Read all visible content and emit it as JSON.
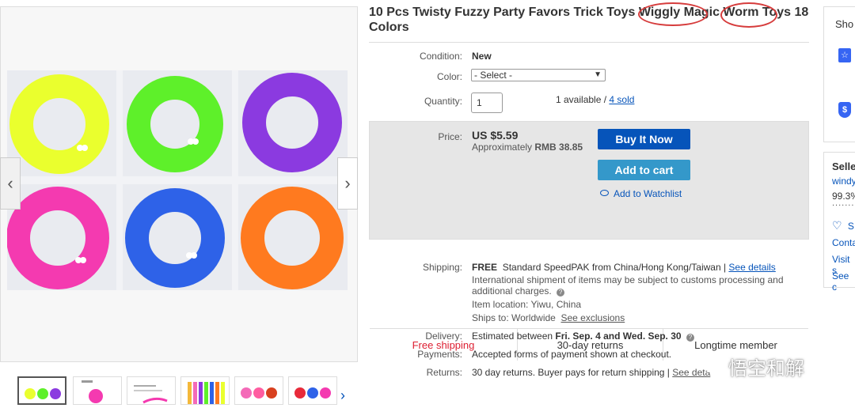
{
  "title": "10 Pcs Twisty Fuzzy Party Favors Trick Toys Wiggly Magic Worm Toys 18 Colors",
  "labels": {
    "condition": "Condition:",
    "color": "Color:",
    "quantity": "Quantity:",
    "price": "Price:",
    "shipping": "Shipping:",
    "delivery": "Delivery:",
    "payments": "Payments:",
    "returns": "Returns:"
  },
  "condition": "New",
  "color_select": "- Select -",
  "quantity_value": "1",
  "availability": {
    "available": "1 available / ",
    "sold": "4 sold"
  },
  "price": {
    "main": "US $5.59",
    "approx_prefix": "Approximately ",
    "approx_value": "RMB 38.85"
  },
  "buttons": {
    "buy": "Buy It Now",
    "cart": "Add to cart",
    "watch": "Add to Watchlist"
  },
  "features": [
    "Free shipping",
    "30-day returns",
    "Longtime member"
  ],
  "shipping": {
    "free": "FREE",
    "method": "Standard SpeedPAK from China/Hong Kong/Taiwan | ",
    "details_link": "See details",
    "note1": "International shipment of items may be subject to customs processing and",
    "note2": "additional charges.",
    "location": "Item location: Yiwu, China",
    "ships_to": "Ships to: Worldwide",
    "exclusions_link": "See exclusions"
  },
  "delivery": {
    "prefix": "Estimated between ",
    "dates": "Fri. Sep. 4 and Wed. Sep. 30"
  },
  "payments": "Accepted forms of payment shown at checkout.",
  "returns": {
    "text": "30 day returns. Buyer pays for return shipping | ",
    "link": "See deta"
  },
  "right_panel": {
    "shop": "Sho",
    "seller": "Selle",
    "seller_name": "windy",
    "feedback": "99.3%",
    "dots": "........",
    "save": "S",
    "contact": "Conta",
    "visit": "Visit s",
    "see": "See c"
  },
  "watermark": "悟空和解",
  "colors": {
    "accent_blue": "#0654ba",
    "cart_blue": "#3498ca",
    "free_shipping_red": "#dd1e31",
    "annotation_red": "#d63c3c"
  }
}
